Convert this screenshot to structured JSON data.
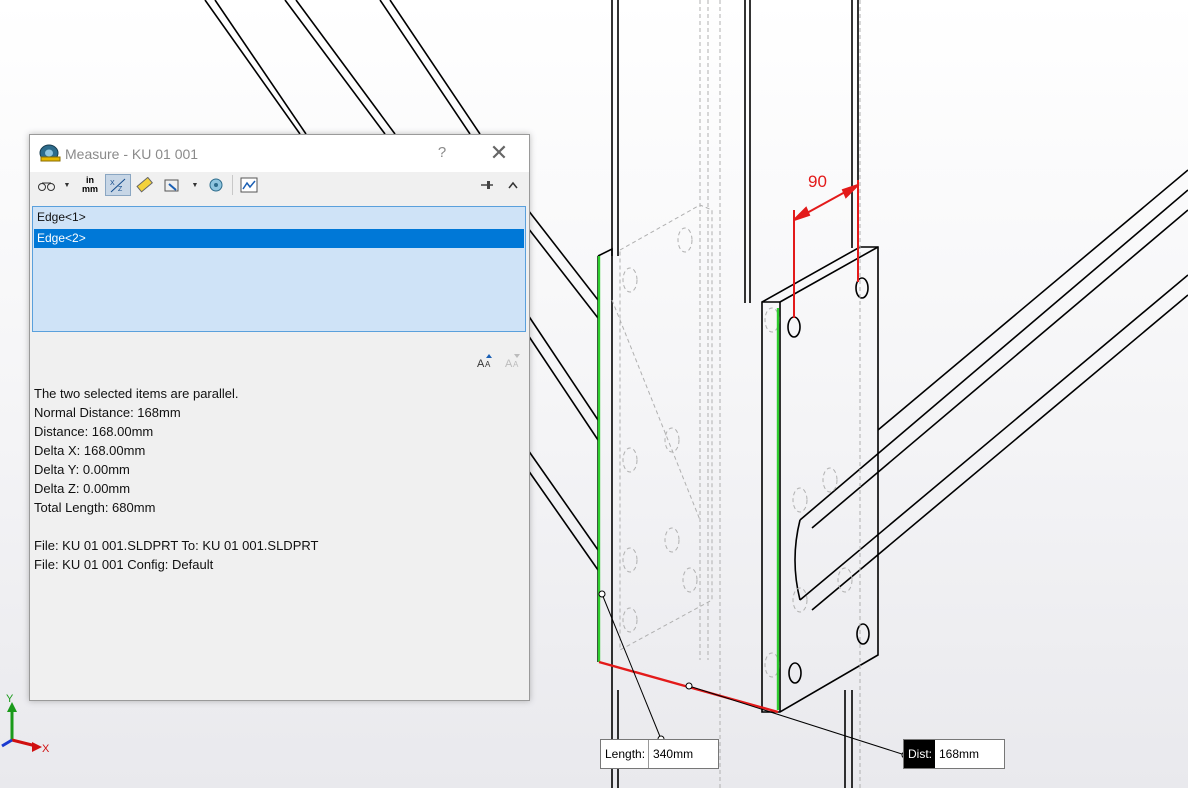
{
  "dialog": {
    "title": "Measure - KU 01 001",
    "help_label": "?",
    "close_label": "✕",
    "toolbar": {
      "units_top": "in",
      "units_bottom": "mm"
    },
    "selections": [
      "Edge<1>",
      "Edge<2>"
    ],
    "selected_index": 1,
    "results": [
      "The two selected items are parallel.",
      "Normal Distance: 168mm",
      "Distance: 168.00mm",
      "Delta X: 168.00mm",
      "Delta Y: 0.00mm",
      "Delta Z: 0.00mm",
      "Total Length: 680mm",
      "",
      "File: KU 01 001.SLDPRT To: KU 01 001.SLDPRT",
      "File: KU 01 001 Config: Default"
    ]
  },
  "viewport": {
    "dimension_label": "90",
    "length_callout": {
      "label": "Length:",
      "value": "340mm"
    },
    "dist_callout": {
      "label": "Dist:",
      "value": "168mm"
    },
    "axes": {
      "y": "Y",
      "x": "X"
    },
    "colors": {
      "selected_edge": "#2ecc2e",
      "dimension": "#e31a1a",
      "measure_line": "#e31a1a"
    }
  }
}
